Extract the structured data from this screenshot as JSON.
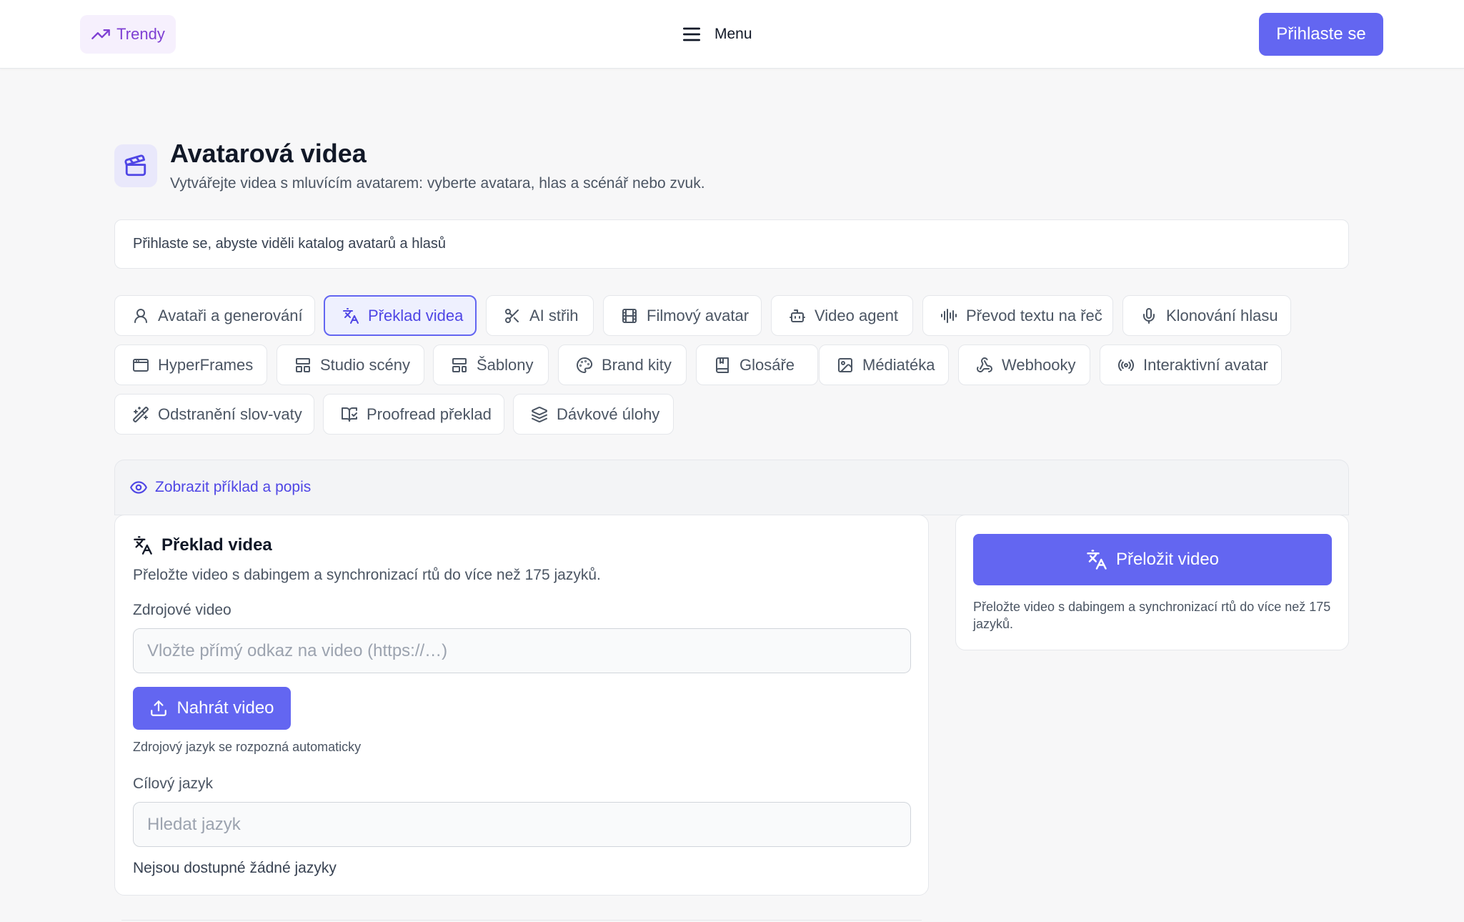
{
  "header": {
    "trendy_label": "Trendy",
    "menu_label": "Menu",
    "login_label": "Přihlaste se"
  },
  "page": {
    "title": "Avatarová videa",
    "subtitle": "Vytvářejte videa s mluvícím avatarem: vyberte avatara, hlas a scénář nebo zvuk.",
    "notice": "Přihlaste se, abyste viděli katalog avatarů a hlasů"
  },
  "tabs": [
    {
      "label": "Avataři a generování",
      "icon": "user-icon"
    },
    {
      "label": "Překlad videa",
      "icon": "translate-icon",
      "active": true
    },
    {
      "label": "AI střih",
      "icon": "scissors-icon"
    },
    {
      "label": "Filmový avatar",
      "icon": "film-icon"
    },
    {
      "label": "Video agent",
      "icon": "bot-icon"
    },
    {
      "label": "Převod textu na řeč",
      "icon": "audio-wave-icon"
    },
    {
      "label": "Klonování hlasu",
      "icon": "microphone-icon"
    },
    {
      "label": "HyperFrames",
      "icon": "browser-window-icon"
    },
    {
      "label": "Studio scény",
      "icon": "layout-icon"
    },
    {
      "label": "Šablony",
      "icon": "template-icon"
    },
    {
      "label": "Brand kity",
      "icon": "palette-icon"
    },
    {
      "label": "Glosáře",
      "icon": "book-icon"
    },
    {
      "label": "Médiatéka",
      "icon": "image-icon"
    },
    {
      "label": "Webhooky",
      "icon": "webhook-icon"
    },
    {
      "label": "Interaktivní avatar",
      "icon": "radio-icon"
    },
    {
      "label": "Odstranění slov-vaty",
      "icon": "magic-wand-icon"
    },
    {
      "label": "Proofread překlad",
      "icon": "book-open-check-icon"
    },
    {
      "label": "Dávkové úlohy",
      "icon": "layers-icon"
    }
  ],
  "example": {
    "label": "Zobrazit příklad a popis"
  },
  "form": {
    "title": "Překlad videa",
    "description": "Přeložte video s dabingem a synchronizací rtů do více než 175 jazyků.",
    "source_label": "Zdrojové video",
    "source_placeholder": "Vložte přímý odkaz na video (https://…)",
    "upload_label": "Nahrát video",
    "auto_detect_hint": "Zdrojový jazyk se rozpozná automaticky",
    "target_label": "Cílový jazyk",
    "target_placeholder": "Hledat jazyk",
    "no_languages": "Nejsou dostupné žádné jazyky"
  },
  "action": {
    "translate_label": "Přeložit video",
    "description": "Přeložte video s dabingem a synchronizací rtů do více než 175 jazyků."
  },
  "colors": {
    "accent": "#6366f1",
    "accent_text": "#4f46e5",
    "trendy": "#7e3fd3"
  }
}
